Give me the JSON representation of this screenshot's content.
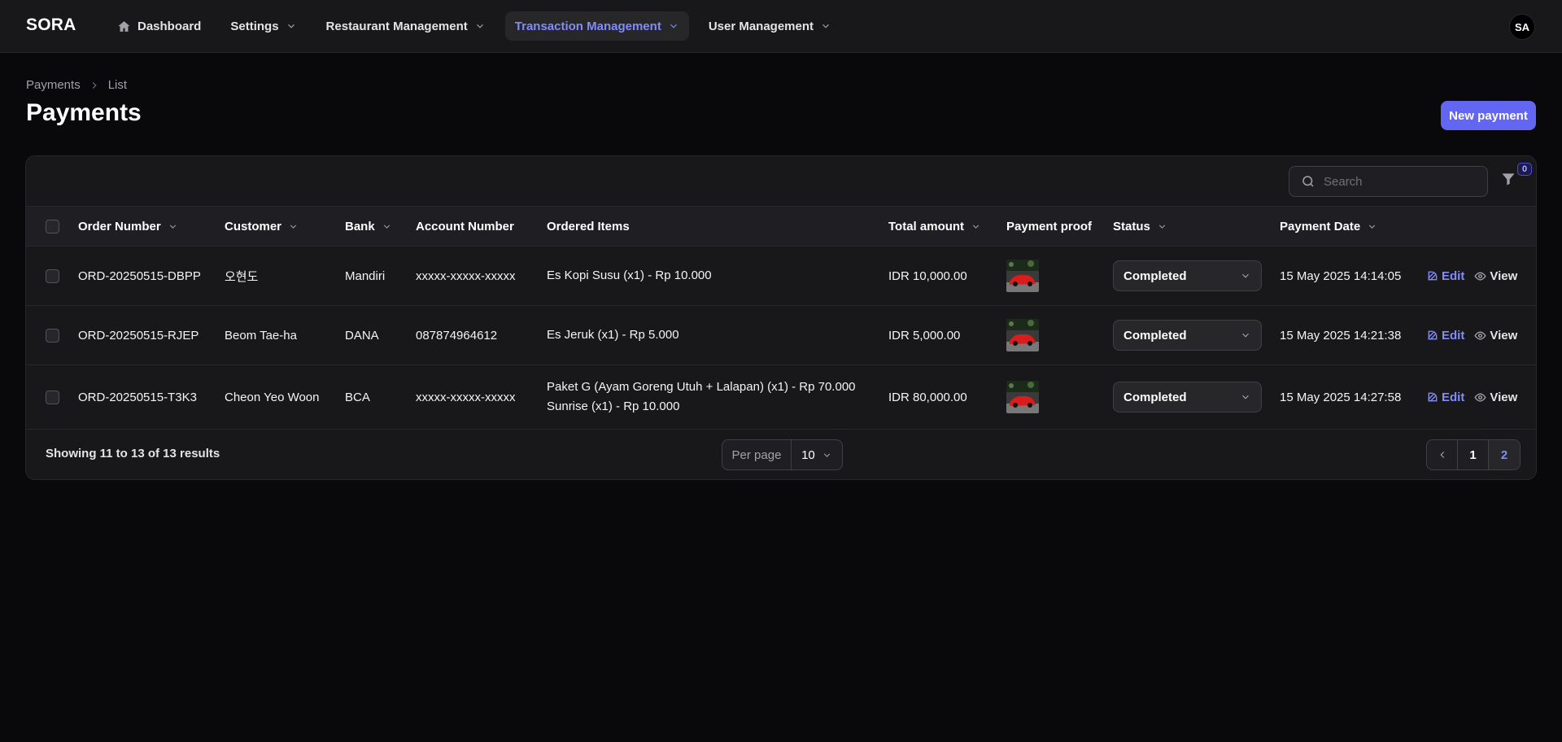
{
  "app": {
    "brand": "SORA",
    "avatar_initials": "SA"
  },
  "nav": [
    {
      "label": "Dashboard",
      "icon": "home-icon",
      "has_dropdown": false,
      "active": false
    },
    {
      "label": "Settings",
      "has_dropdown": true,
      "active": false
    },
    {
      "label": "Restaurant Management",
      "has_dropdown": true,
      "active": false
    },
    {
      "label": "Transaction Management",
      "has_dropdown": true,
      "active": true
    },
    {
      "label": "User Management",
      "has_dropdown": true,
      "active": false
    }
  ],
  "breadcrumb": [
    "Payments",
    "List"
  ],
  "page": {
    "title": "Payments",
    "primary_action": "New payment"
  },
  "toolbar": {
    "search_placeholder": "Search",
    "filter_count": "0"
  },
  "table": {
    "headers": [
      "Order Number",
      "Customer",
      "Bank",
      "Account Number",
      "Ordered Items",
      "Total amount",
      "Payment proof",
      "Status",
      "Payment Date"
    ],
    "rows": [
      {
        "order_number": "ORD-20250515-DBPP",
        "customer": "오현도",
        "bank": "Mandiri",
        "account_number": "xxxxx-xxxxx-xxxxx",
        "ordered_items": [
          "Es Kopi Susu (x1) - Rp 10.000"
        ],
        "total_amount": "IDR 10,000.00",
        "status": "Completed",
        "payment_date": "15 May 2025 14:14:05"
      },
      {
        "order_number": "ORD-20250515-RJEP",
        "customer": "Beom Tae-ha",
        "bank": "DANA",
        "account_number": "087874964612",
        "ordered_items": [
          "Es Jeruk (x1) - Rp 5.000"
        ],
        "total_amount": "IDR 5,000.00",
        "status": "Completed",
        "payment_date": "15 May 2025 14:21:38"
      },
      {
        "order_number": "ORD-20250515-T3K3",
        "customer": "Cheon Yeo Woon",
        "bank": "BCA",
        "account_number": "xxxxx-xxxxx-xxxxx",
        "ordered_items": [
          "Paket G (Ayam Goreng Utuh + Lalapan) (x1) - Rp 70.000",
          "Sunrise (x1) - Rp 10.000"
        ],
        "total_amount": "IDR 80,000.00",
        "status": "Completed",
        "payment_date": "15 May 2025 14:27:58"
      }
    ],
    "row_actions": {
      "edit": "Edit",
      "view": "View"
    }
  },
  "footer": {
    "showing_text": "Showing 11 to 13 of 13 results",
    "per_page_label": "Per page",
    "per_page_value": "10",
    "pages": [
      "1",
      "2"
    ],
    "current_page": "2"
  },
  "colors": {
    "accent": "#6366f1",
    "accent_text": "#818cf8",
    "background": "#09090b",
    "surface": "#18181b"
  }
}
